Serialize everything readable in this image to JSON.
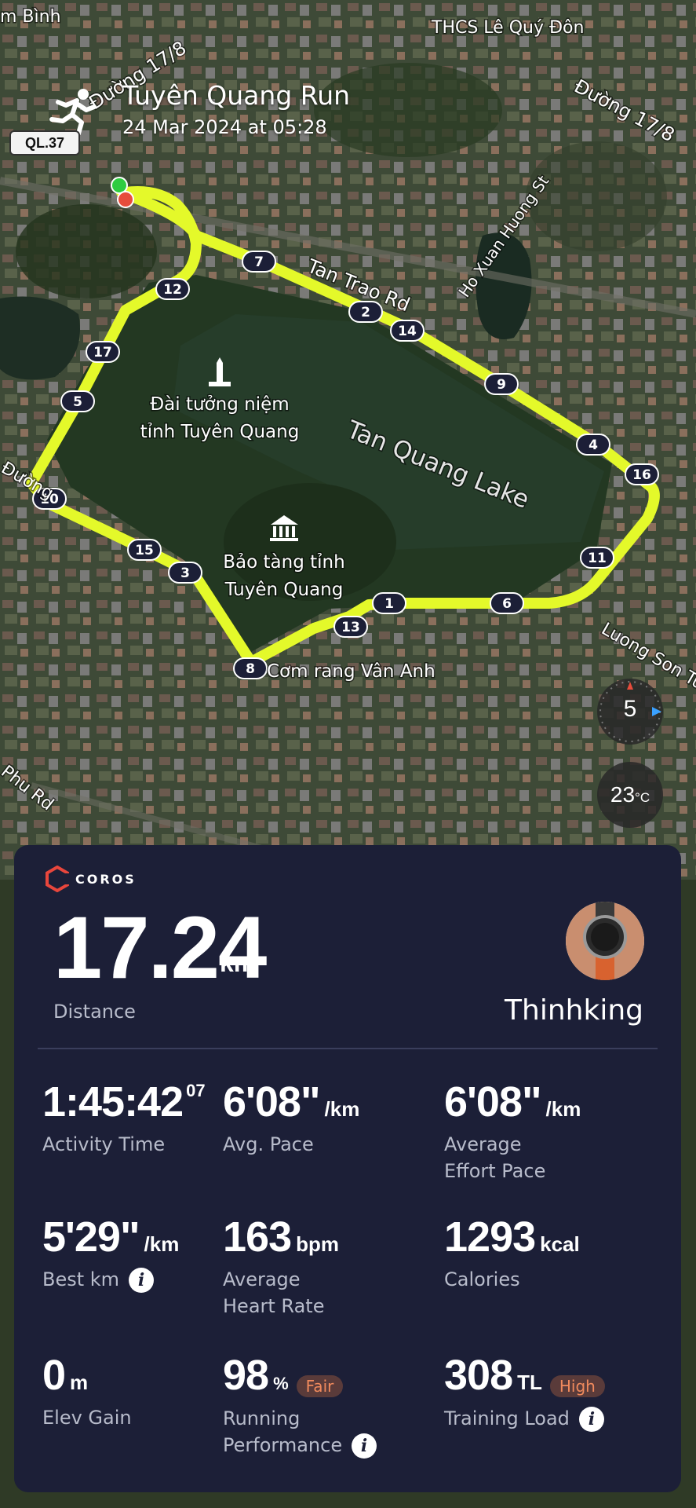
{
  "activity": {
    "title": "Tuyên Quang Run",
    "date": "24 Mar 2024 at 05:28",
    "road_badge": "QL.37"
  },
  "map_labels": {
    "top_left": "m Bình",
    "school": "THCS Lê Quý Đôn",
    "road_17_8_left": "Đường 17/8",
    "road_17_8_right": "Đường 17/8",
    "tan_trao": "Tan Trao Rd",
    "ho_xuan_huong": "Ho Xuan Huong St",
    "monument_1": "Đài tưởng niệm",
    "monument_2": "tỉnh Tuyên Quang",
    "lake": "Tan Quang Lake",
    "museum_1": "Bảo tàng tỉnh",
    "museum_2": "Tuyên Quang",
    "restaurant": "Cơm rang Vân Anh",
    "luong_son": "Luong Son Tu",
    "phu_rd": "Phu Rd",
    "duong_left": "Đường"
  },
  "km_markers": [
    "1",
    "2",
    "3",
    "4",
    "5",
    "6",
    "7",
    "8",
    "9",
    "10",
    "11",
    "12",
    "13",
    "14",
    "15",
    "16",
    "17"
  ],
  "compass": {
    "value": "5"
  },
  "temperature": {
    "value": "23",
    "unit": "°C"
  },
  "brand": {
    "name": "COROS",
    "color": "#e8463c"
  },
  "route_color": "#e4f92a",
  "summary": {
    "distance_value": "17.24",
    "distance_unit": "km",
    "distance_label": "Distance",
    "username": "Thinhking"
  },
  "metrics": {
    "activity_time": {
      "value": "1:45:42",
      "sup": "07",
      "label": "Activity Time"
    },
    "avg_pace": {
      "value": "6'08\"",
      "unit": "/km",
      "label": "Avg. Pace"
    },
    "effort_pace": {
      "value": "6'08\"",
      "unit": "/km",
      "label_1": "Average",
      "label_2": "Effort Pace"
    },
    "best_km": {
      "value": "5'29\"",
      "unit": "/km",
      "label": "Best km"
    },
    "heart_rate": {
      "value": "163",
      "unit": "bpm",
      "label_1": "Average",
      "label_2": "Heart Rate"
    },
    "calories": {
      "value": "1293",
      "unit": "kcal",
      "label": "Calories"
    },
    "elev_gain": {
      "value": "0",
      "unit": "m",
      "label": "Elev Gain"
    },
    "running_performance": {
      "value": "98",
      "unit": "%",
      "badge": "Fair",
      "label_1": "Running",
      "label_2": "Performance"
    },
    "training_load": {
      "value": "308",
      "unit": "TL",
      "badge": "High",
      "label": "Training Load"
    }
  },
  "info_glyph": "i"
}
